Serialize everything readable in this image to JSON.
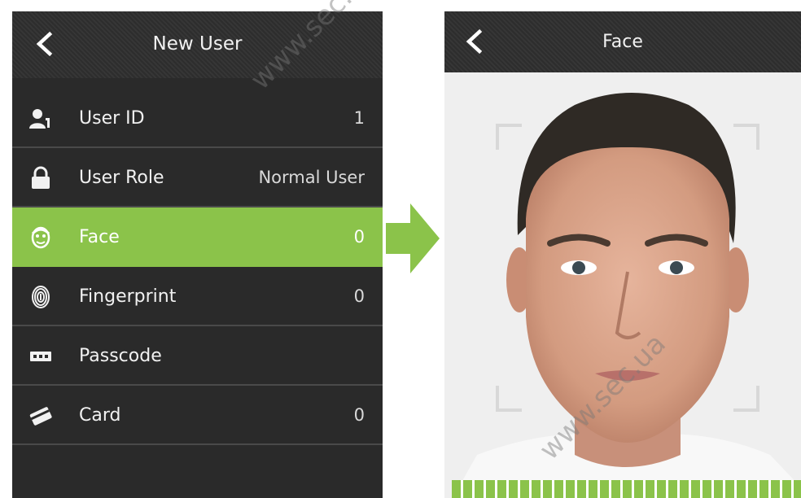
{
  "left_screen": {
    "title": "New User",
    "items": [
      {
        "icon": "user-id-icon",
        "label": "User ID",
        "value": "1",
        "active": false
      },
      {
        "icon": "lock-icon",
        "label": "User Role",
        "value": "Normal User",
        "active": false
      },
      {
        "icon": "face-icon",
        "label": "Face",
        "value": "0",
        "active": true
      },
      {
        "icon": "fingerprint-icon",
        "label": "Fingerprint",
        "value": "0",
        "active": false
      },
      {
        "icon": "passcode-icon",
        "label": "Passcode",
        "value": "",
        "active": false
      },
      {
        "icon": "card-icon",
        "label": "Card",
        "value": "0",
        "active": false
      }
    ]
  },
  "right_screen": {
    "title": "Face"
  },
  "colors": {
    "accent": "#8bc34a",
    "header_bg": "#2f2f2f",
    "menu_bg": "#2a2a2a"
  },
  "watermarks": [
    "www.sec.ua",
    "www.sec.ua"
  ]
}
